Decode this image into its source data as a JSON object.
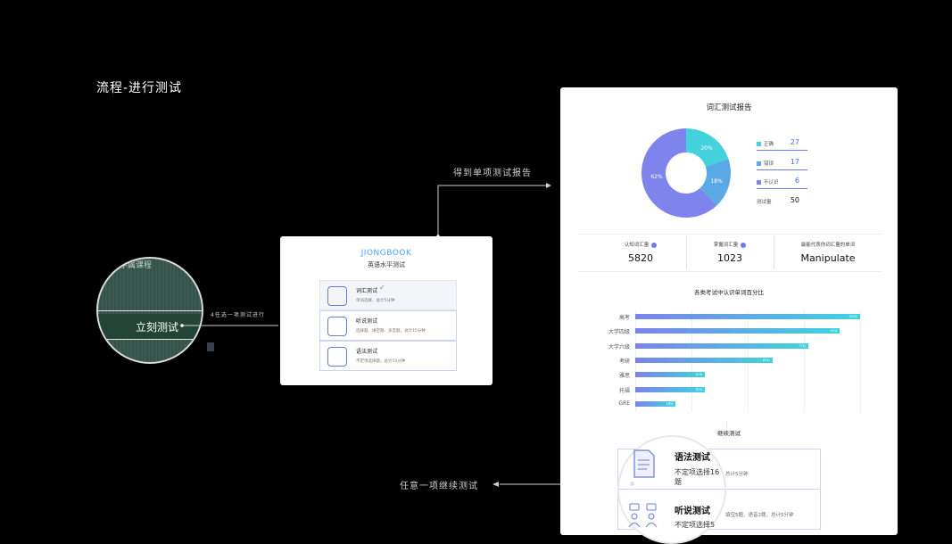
{
  "flow_title": "流程-进行测试",
  "annotations": {
    "get_report": "得到单项测试报告",
    "select_start": "4任选一项测试进行",
    "continue_any": "任意一项继续测试"
  },
  "lens": {
    "top_text": "学属课程",
    "button": "立刻测试"
  },
  "card": {
    "logo": "JIONGBOOK",
    "subtitle": "英语水平测试",
    "options": [
      {
        "title": "词汇测试",
        "desc": "单词选择，总计5分钟",
        "checked": true
      },
      {
        "title": "听说测试",
        "desc": "选择题、填空题、多音题，总计15分钟",
        "checked": false
      },
      {
        "title": "语法测试",
        "desc": "不定项选择题，总计10分钟",
        "checked": false
      }
    ]
  },
  "report": {
    "title": "词汇测试报告",
    "pie": {
      "slices": [
        {
          "label": "正确",
          "value": 27,
          "pct": 20,
          "color": "#44d2dd"
        },
        {
          "label": "错误",
          "value": 17,
          "pct": 18,
          "color": "#5aa8e6"
        },
        {
          "label": "不认识",
          "value": 6,
          "pct": 62,
          "color": "#7f84ec"
        }
      ],
      "pct_labels": [
        "20%",
        "18%",
        "62%"
      ],
      "total_label": "测试量",
      "total_value": "50"
    },
    "stats": [
      {
        "label": "认知词汇量",
        "value": "5820"
      },
      {
        "label": "掌握词汇量",
        "value": "1023"
      },
      {
        "label": "最能代表你词汇量的单词",
        "value": "Manipulate"
      }
    ],
    "bars_title": "各类考试中认识单词百分比",
    "continue_title": "继续测试"
  },
  "chart_data": {
    "type": "bar",
    "title": "各类考试中认识单词百分比",
    "categories": [
      "高考",
      "大学四级",
      "大学六级",
      "考研",
      "雅思",
      "托福",
      "GRE"
    ],
    "values": [
      100,
      91,
      77,
      61,
      31,
      31,
      18
    ],
    "value_labels": [
      "100%",
      "91%",
      "77%",
      "61%",
      "31%",
      "31%",
      "18%"
    ],
    "ylim": [
      0,
      100
    ]
  },
  "continue_items": [
    {
      "title": "语法测试",
      "desc": "不定项选择16题",
      "extra": "总计5分钟"
    },
    {
      "title": "听说测试",
      "desc": "不定项选择5",
      "extra": "填空5题、语音2题，总计5分钟"
    }
  ],
  "colors": {
    "accent": "#6d7df0",
    "teal": "#40d3df",
    "background": "#000000"
  }
}
